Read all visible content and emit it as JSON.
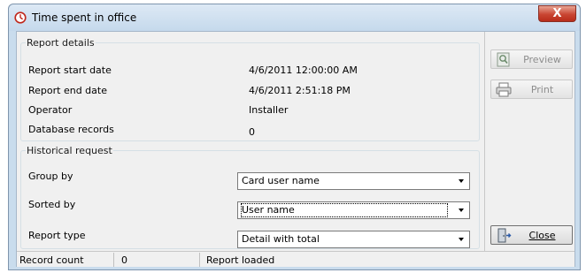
{
  "window": {
    "title": "Time spent in office",
    "close_glyph": "X"
  },
  "report_details": {
    "legend": "Report details",
    "rows": [
      {
        "label": "Report start date",
        "value": "4/6/2011 12:00:00 AM"
      },
      {
        "label": "Report end date",
        "value": "4/6/2011 2:51:18 PM"
      },
      {
        "label": "Operator",
        "value": "Installer"
      },
      {
        "label": "Database records",
        "value": "0"
      }
    ]
  },
  "historical_request": {
    "legend": "Historical request",
    "group_by": {
      "label": "Group by",
      "value": "Card user name"
    },
    "sorted_by": {
      "label": "Sorted by",
      "value": "User name"
    },
    "report_type": {
      "label": "Report type",
      "value": "Detail with total"
    }
  },
  "buttons": {
    "preview": "Preview",
    "print": "Print",
    "close": "Close"
  },
  "status": {
    "record_count_label": "Record count",
    "record_count_value": "0",
    "message": "Report loaded"
  },
  "icons": {
    "title": "clock-icon",
    "preview": "preview-icon",
    "print": "printer-icon",
    "close": "exit-door-icon"
  },
  "colors": {
    "close_button": "#c94532",
    "titlebar": "#c5d9ec",
    "client_bg": "#f0f0f0"
  }
}
